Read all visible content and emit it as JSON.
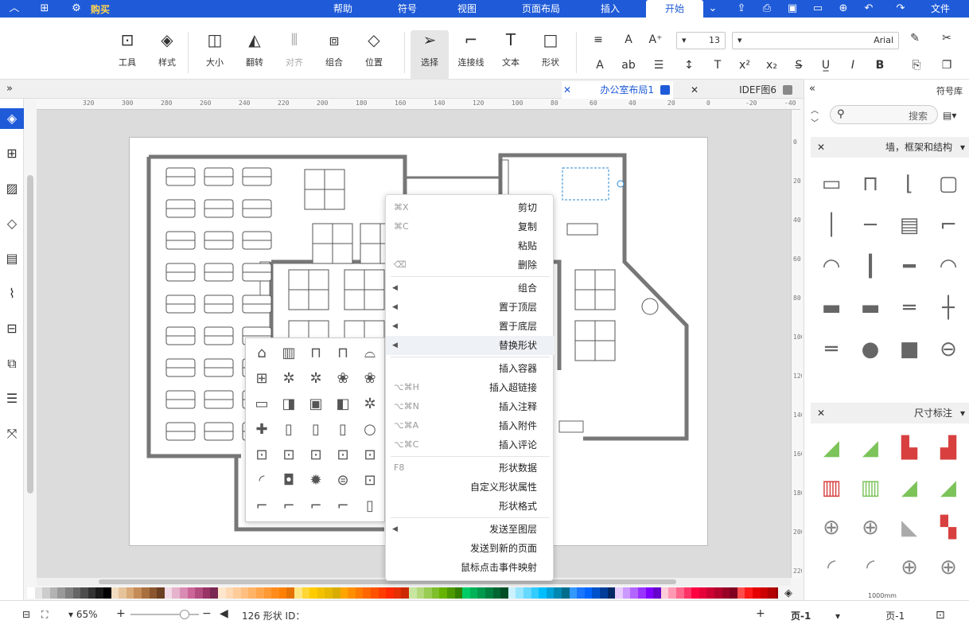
{
  "topbar": {
    "tabs": [
      {
        "id": "file",
        "label": "文件"
      },
      {
        "id": "home",
        "label": "开始"
      },
      {
        "id": "insert",
        "label": "插入"
      },
      {
        "id": "layout",
        "label": "页面布局"
      },
      {
        "id": "view",
        "label": "视图"
      },
      {
        "id": "symbol",
        "label": "符号"
      },
      {
        "id": "help",
        "label": "帮助"
      }
    ],
    "buy_label": "购买"
  },
  "ribbon": {
    "font_name": "Arial",
    "font_size": "13",
    "buttons": [
      {
        "id": "select",
        "label": "选择"
      },
      {
        "id": "connector",
        "label": "连接线"
      },
      {
        "id": "text",
        "label": "文本"
      },
      {
        "id": "shape",
        "label": "形状"
      },
      {
        "id": "position",
        "label": "位置"
      },
      {
        "id": "group",
        "label": "组合"
      },
      {
        "id": "align",
        "label": "对齐"
      },
      {
        "id": "flip",
        "label": "翻转"
      },
      {
        "id": "size",
        "label": "大小"
      },
      {
        "id": "style",
        "label": "样式"
      },
      {
        "id": "tools",
        "label": "工具"
      }
    ]
  },
  "doc_tabs": [
    {
      "label": "IDEF图6"
    },
    {
      "label": "办公室布局1"
    }
  ],
  "ruler": {
    "h_ticks": [
      "-40",
      "-20",
      "0",
      "20",
      "40",
      "60",
      "80",
      "100",
      "120",
      "140",
      "160",
      "180",
      "200",
      "220",
      "240",
      "260",
      "280",
      "300",
      "320"
    ],
    "v_ticks": [
      "0",
      "20",
      "40",
      "60",
      "80",
      "100",
      "120",
      "140",
      "160",
      "180",
      "200",
      "220"
    ]
  },
  "context_menu": {
    "groups": [
      [
        {
          "id": "cut",
          "label": "剪切",
          "shortcut": "⌘X"
        },
        {
          "id": "copy",
          "label": "复制",
          "shortcut": "⌘C"
        },
        {
          "id": "paste",
          "label": "粘贴",
          "shortcut": ""
        },
        {
          "id": "delete",
          "label": "删除",
          "shortcut": "⌫"
        }
      ],
      [
        {
          "id": "group",
          "label": "组合",
          "submenu": true
        },
        {
          "id": "bring_front",
          "label": "置于顶层",
          "submenu": true
        },
        {
          "id": "send_back",
          "label": "置于底层",
          "submenu": true
        },
        {
          "id": "replace_shape",
          "label": "替换形状",
          "submenu": true,
          "highlight": true
        }
      ],
      [
        {
          "id": "insert_container",
          "label": "插入容器",
          "shortcut": ""
        },
        {
          "id": "insert_hyperlink",
          "label": "插入超链接",
          "shortcut": "⌥⌘H"
        },
        {
          "id": "insert_note",
          "label": "插入注释",
          "shortcut": "⌥⌘N"
        },
        {
          "id": "insert_attachment",
          "label": "插入附件",
          "shortcut": "⌥⌘A"
        },
        {
          "id": "insert_comment",
          "label": "插入评论",
          "shortcut": "⌥⌘C"
        }
      ],
      [
        {
          "id": "shape_data",
          "label": "形状数据",
          "shortcut": "F8"
        },
        {
          "id": "custom_props",
          "label": "自定义形状属性",
          "shortcut": ""
        },
        {
          "id": "shape_format",
          "label": "形状格式",
          "shortcut": ""
        }
      ],
      [
        {
          "id": "send_to_layer",
          "label": "发送至图层",
          "submenu": true
        },
        {
          "id": "send_to_page",
          "label": "发送到新的页面",
          "shortcut": ""
        },
        {
          "id": "mouse_event",
          "label": "鼠标点击事件映射",
          "shortcut": ""
        }
      ]
    ]
  },
  "library": {
    "title": "符号库",
    "search_placeholder": "搜索",
    "sections": [
      {
        "id": "walls",
        "label": "墙，框架和结构"
      },
      {
        "id": "dims",
        "label": "尺寸标注"
      }
    ],
    "dim_label": "1000mm"
  },
  "status": {
    "page_selector": "页-1",
    "page_tab": "页-1",
    "shape_id_label": "形状 ID：",
    "shape_id": "126",
    "zoom": "65%"
  },
  "colors": [
    "#ffffff",
    "#e6e6e6",
    "#cccccc",
    "#b3b3b3",
    "#999999",
    "#808080",
    "#666666",
    "#4d4d4d",
    "#333333",
    "#1a1a1a",
    "#000000",
    "#f2dcc0",
    "#e6c39b",
    "#d9a978",
    "#c68c58",
    "#a8703f",
    "#8a5630",
    "#6b3f22",
    "#f2d9e6",
    "#e6b3cc",
    "#d98cb3",
    "#cc6699",
    "#b34d80",
    "#993366",
    "#7a2952",
    "#ffe6cc",
    "#ffd9b3",
    "#ffcc99",
    "#ffbf80",
    "#ffb366",
    "#ffa64d",
    "#ff9933",
    "#ff8c1a",
    "#ff8000",
    "#e67300",
    "#ffe680",
    "#ffd633",
    "#ffcc00",
    "#f2c200",
    "#e6b800",
    "#d9ad00",
    "#ffa500",
    "#ff8f00",
    "#ff7a00",
    "#ff6600",
    "#ff5200",
    "#ff3d00",
    "#ff2900",
    "#e62e00",
    "#cc2900",
    "#c9e6a1",
    "#b3d97a",
    "#99cc52",
    "#7fbf2b",
    "#66b300",
    "#4d9900",
    "#338000",
    "#00cc66",
    "#00b359",
    "#00994d",
    "#008040",
    "#006633",
    "#004d26",
    "#ccf2ff",
    "#99e6ff",
    "#66d9ff",
    "#33ccff",
    "#00bfff",
    "#00a3d9",
    "#0088b3",
    "#006d8c",
    "#3399ff",
    "#1a75ff",
    "#0066ff",
    "#0052cc",
    "#003d99",
    "#002966",
    "#e6ccff",
    "#cc99ff",
    "#b366ff",
    "#9933ff",
    "#8000ff",
    "#6600cc",
    "#ffccd9",
    "#ff99b3",
    "#ff668c",
    "#ff3366",
    "#ff0040",
    "#e6003a",
    "#cc0033",
    "#b3002d",
    "#990026",
    "#800020",
    "#ff4d4d",
    "#ff1a1a",
    "#e60000",
    "#cc0000",
    "#b30000",
    "#990000",
    "#800000",
    "#c00000"
  ]
}
